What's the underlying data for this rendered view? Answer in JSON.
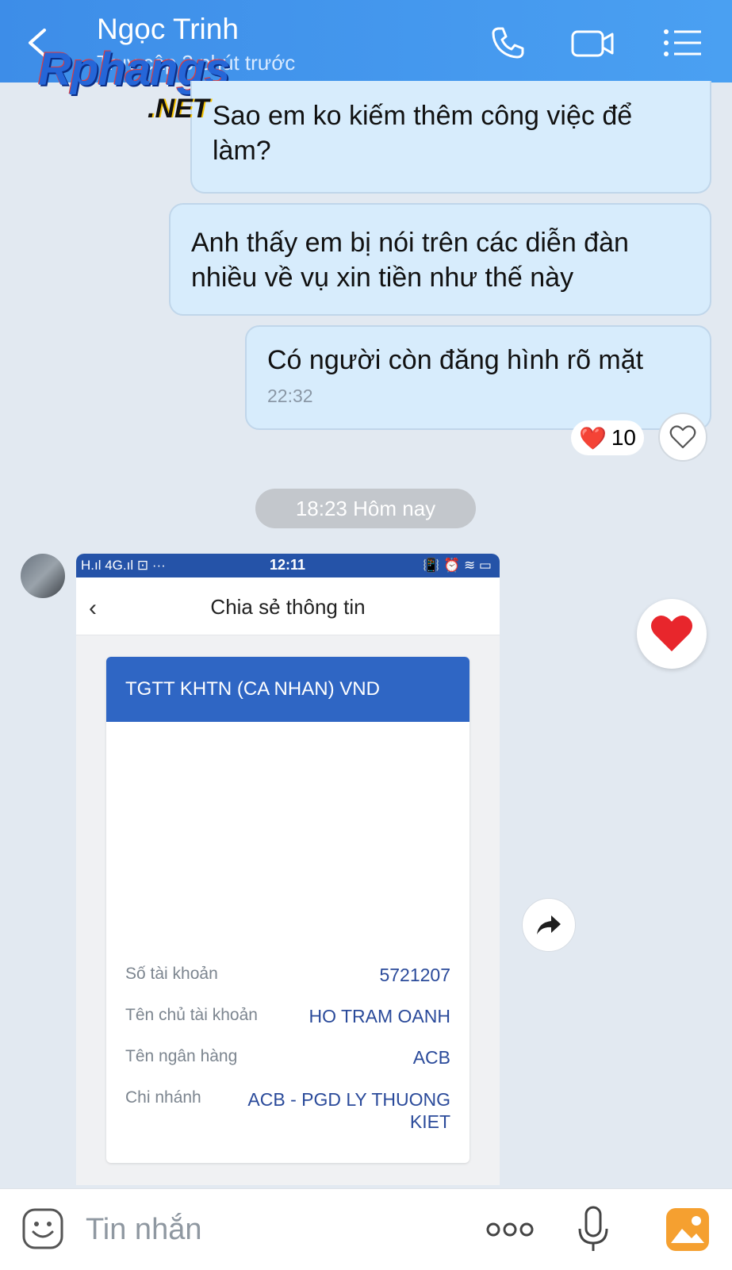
{
  "header": {
    "title": "Ngọc Trinh",
    "status": "Truy cập 3 phút trước",
    "colors": {
      "background": "#4aa0f2",
      "text": "#ffffff"
    },
    "icons": {
      "back": "back-chevron-icon",
      "call": "phone-icon",
      "video": "video-camera-icon",
      "menu": "list-menu-icon"
    }
  },
  "watermark": {
    "main": "Rphangs",
    "suffix": ".NET"
  },
  "messages": [
    {
      "text": "Sao em ko kiếm thêm công việc để làm?"
    },
    {
      "text": "Anh thấy em bị nói trên các diễn đàn nhiều về vụ xin tiền như thế này"
    },
    {
      "text": "Có người còn đăng hình rõ mặt",
      "time": "22:32"
    }
  ],
  "reaction": {
    "emoji": "❤️",
    "count": "10"
  },
  "date_separator": "18:23 Hôm nay",
  "shared_image": {
    "status_bar": {
      "left": "H.ıl 4G.ıl ⊡ ···",
      "time": "12:11",
      "right": "📳 ⏰ ≋ ▭"
    },
    "nav_title": "Chia sẻ thông tin",
    "card": {
      "header": "TGTT KHTN (CA NHAN) VND",
      "rows": [
        {
          "label": "Số tài khoản",
          "value": "5721207"
        },
        {
          "label": "Tên chủ tài khoản",
          "value": "HO TRAM OANH"
        },
        {
          "label": "Tên ngân hàng",
          "value": "ACB"
        },
        {
          "label": "Chi nhánh",
          "value": "ACB - PGD LY THUONG KIET"
        }
      ]
    }
  },
  "composer": {
    "placeholder": "Tin nhắn"
  }
}
